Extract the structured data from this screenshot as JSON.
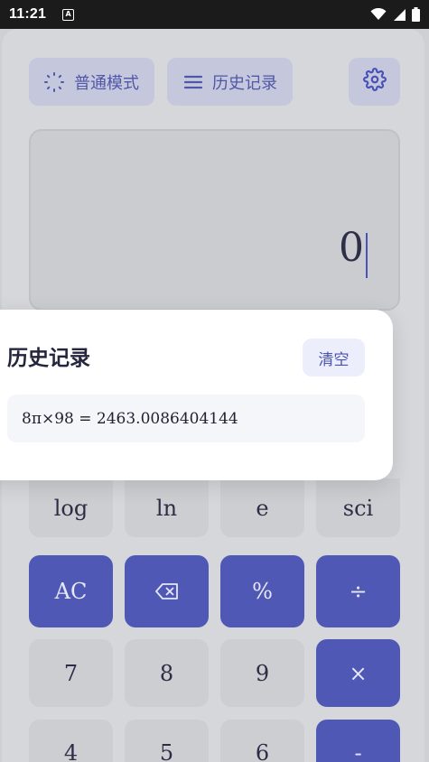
{
  "status_bar": {
    "time": "11:21",
    "notification_icon": "A"
  },
  "toolbar": {
    "mode_label": "普通模式",
    "history_label": "历史记录"
  },
  "display": {
    "value": "0"
  },
  "history_dialog": {
    "title": "历史记录",
    "clear_label": "清空",
    "entries": [
      "8π×98 = 2463.0086404144"
    ]
  },
  "keypad": {
    "row1": [
      "log",
      "ln",
      "e",
      "sci"
    ],
    "row2": [
      "AC",
      "⌫",
      "%",
      "÷"
    ],
    "row3": [
      "7",
      "8",
      "9",
      "×"
    ],
    "row4": [
      "4",
      "5",
      "6",
      "-"
    ]
  },
  "colors": {
    "accent": "#4f59b5",
    "overlay_bg": "#d3d4d7"
  }
}
